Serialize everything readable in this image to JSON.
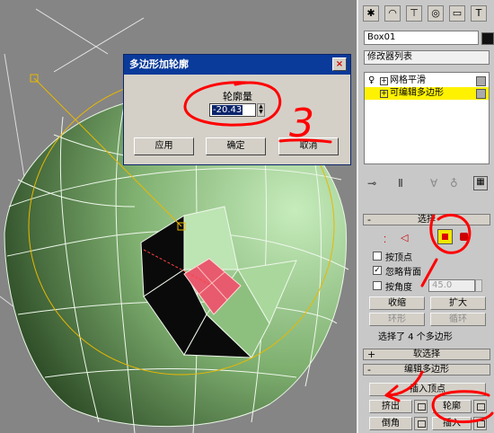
{
  "dialog": {
    "title": "多边形加轮廓",
    "close_glyph": "×",
    "field_label": "轮廓量",
    "outline_amount": "-20.43",
    "buttons": {
      "apply": "应用",
      "ok": "确定",
      "cancel": "取消"
    }
  },
  "command_panel": {
    "tabs": [
      {
        "icon": "create-icon",
        "glyph": "✱"
      },
      {
        "icon": "modify-icon",
        "glyph": "◠"
      },
      {
        "icon": "hierarchy-icon",
        "glyph": "⊤"
      },
      {
        "icon": "motion-icon",
        "glyph": "◎"
      },
      {
        "icon": "display-icon",
        "glyph": "▭"
      },
      {
        "icon": "utilities-icon",
        "glyph": "T"
      }
    ],
    "object_name": "Box01",
    "object_color": "#111111",
    "modifier_list": "修改器列表",
    "stack": [
      {
        "label": "网格平滑",
        "selected": false
      },
      {
        "label": "可编辑多边形",
        "selected": true
      }
    ],
    "stack_highlight_color": "#fff200",
    "selection": {
      "header": "选择",
      "by_vertex": "按顶点",
      "by_vertex_checked": false,
      "ignore_backfacing": "忽略背面",
      "ignore_backfacing_checked": true,
      "by_angle": "按角度",
      "by_angle_checked": false,
      "angle_value": "45.0",
      "shrink": "收缩",
      "grow": "扩大",
      "ring": "环形",
      "loop": "循环",
      "status": "选择了 4 个多边形"
    },
    "soft_selection": {
      "header": "软选择",
      "sign": "+"
    },
    "edit_polygons": {
      "header": "编辑多边形",
      "sign": "-",
      "insert_vertex": "插入顶点",
      "extrude": "挤出",
      "outline": "轮廓",
      "bevel": "倒角",
      "inset": "插入"
    }
  },
  "annotations": {
    "step_number": "3",
    "color": "#ff0000"
  },
  "viewport": {
    "selected_poly_color": "#e85a6e",
    "mesh_color": "#7fb070"
  }
}
